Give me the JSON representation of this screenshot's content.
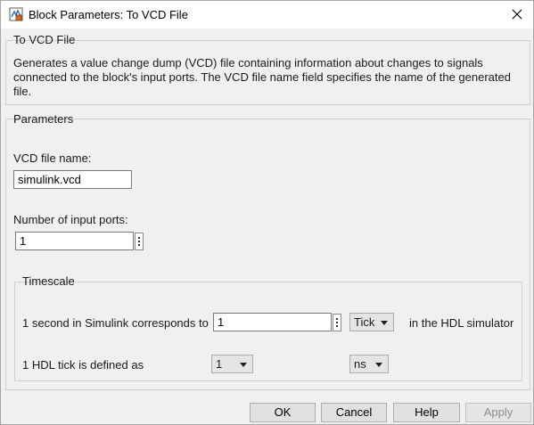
{
  "window": {
    "title": "Block Parameters: To VCD File",
    "app_icon": "simulink-block-icon",
    "close_icon": "close-icon"
  },
  "description_group": {
    "title": "To VCD File",
    "text": "Generates a value change dump (VCD) file containing information about changes to signals connected to the block's input ports. The VCD file name field specifies the name of the generated file."
  },
  "parameters": {
    "title": "Parameters",
    "vcd_file_label": "VCD file name:",
    "vcd_file_value": "simulink.vcd",
    "num_ports_label": "Number of input ports:",
    "num_ports_value": "1",
    "timescale": {
      "title": "Timescale",
      "second_label": "1 second in Simulink corresponds to",
      "second_value": "1",
      "second_unit": "Tick",
      "hdl_suffix": "in the HDL simulator",
      "tick_label": "1 HDL tick is defined as",
      "tick_value": "1",
      "tick_unit": "ns"
    }
  },
  "buttons": {
    "ok": "OK",
    "cancel": "Cancel",
    "help": "Help",
    "apply": "Apply"
  }
}
